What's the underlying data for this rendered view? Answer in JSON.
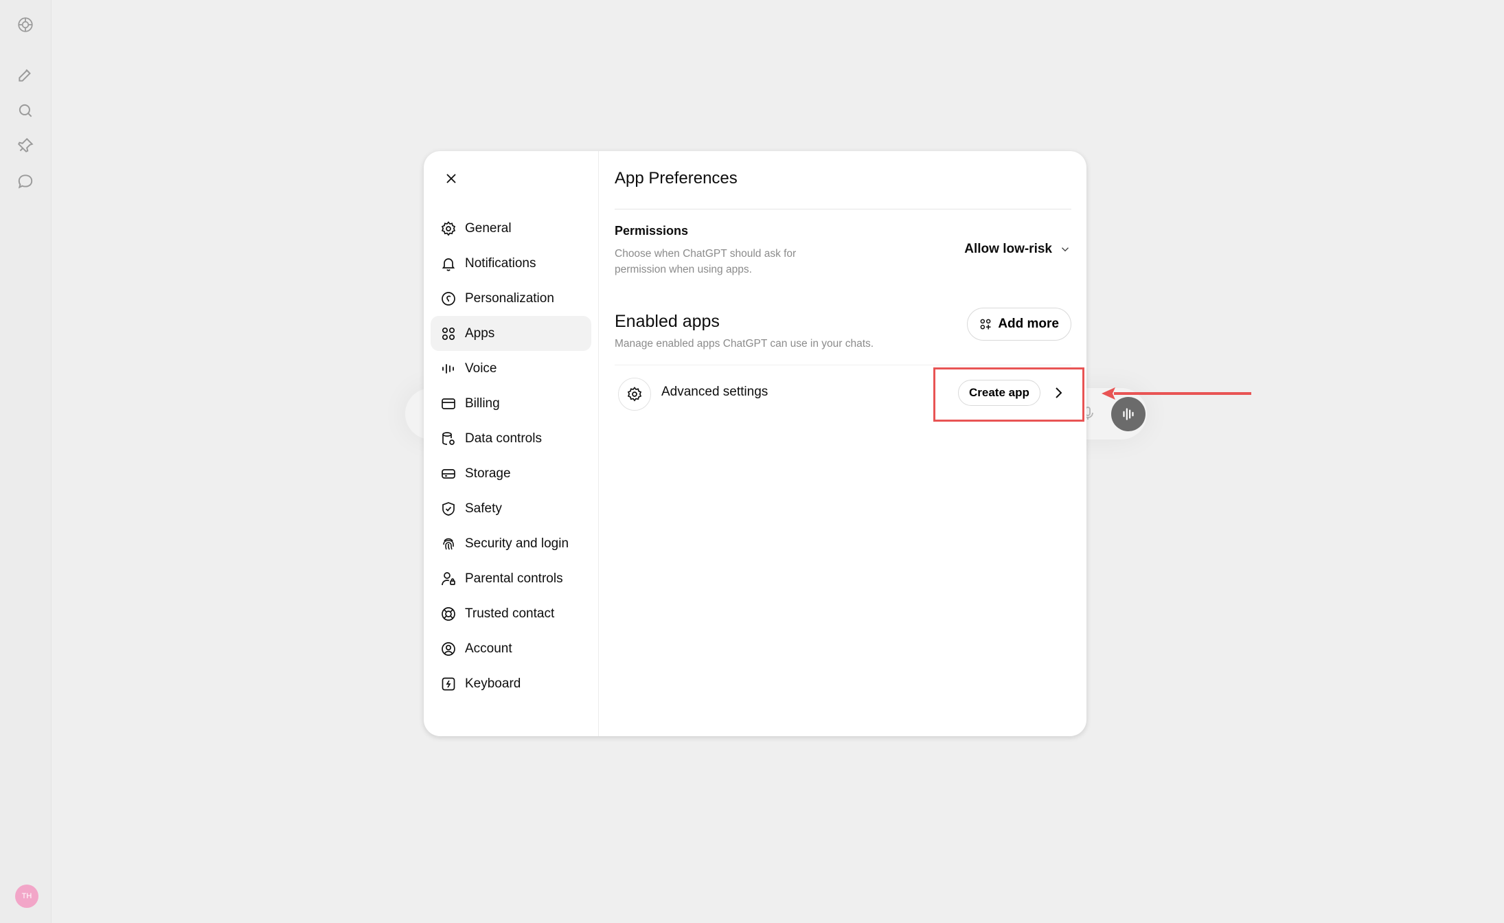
{
  "rail": {
    "icons": [
      "openai-logo-icon",
      "new-chat-icon",
      "search-icon",
      "pin-icon",
      "chat-bubble-icon"
    ],
    "avatar_initials": "TH"
  },
  "modal": {
    "close_icon": "close-icon",
    "sidebar": {
      "items": [
        {
          "label": "General",
          "icon": "gear-icon",
          "active": false
        },
        {
          "label": "Notifications",
          "icon": "bell-icon",
          "active": false
        },
        {
          "label": "Personalization",
          "icon": "personalization-icon",
          "active": false
        },
        {
          "label": "Apps",
          "icon": "apps-grid-icon",
          "active": true
        },
        {
          "label": "Voice",
          "icon": "waveform-icon",
          "active": false
        },
        {
          "label": "Billing",
          "icon": "credit-card-icon",
          "active": false
        },
        {
          "label": "Data controls",
          "icon": "database-icon",
          "active": false
        },
        {
          "label": "Storage",
          "icon": "storage-drive-icon",
          "active": false
        },
        {
          "label": "Safety",
          "icon": "shield-check-icon",
          "active": false
        },
        {
          "label": "Security and login",
          "icon": "fingerprint-icon",
          "active": false
        },
        {
          "label": "Parental controls",
          "icon": "person-lock-icon",
          "active": false
        },
        {
          "label": "Trusted contact",
          "icon": "lifebuoy-icon",
          "active": false
        },
        {
          "label": "Account",
          "icon": "user-circle-icon",
          "active": false
        },
        {
          "label": "Keyboard",
          "icon": "keyboard-icon",
          "active": false
        }
      ]
    },
    "content": {
      "title": "App Preferences",
      "permissions": {
        "title": "Permissions",
        "description": "Choose when ChatGPT should ask for permission when using apps.",
        "selected_value": "Allow low-risk"
      },
      "enabled_apps": {
        "title": "Enabled apps",
        "description": "Manage enabled apps ChatGPT can use in your chats.",
        "add_more_label": "Add more"
      },
      "advanced": {
        "label": "Advanced settings",
        "create_app_label": "Create app"
      }
    }
  },
  "annotation": {
    "highlight_color": "#e85454"
  }
}
